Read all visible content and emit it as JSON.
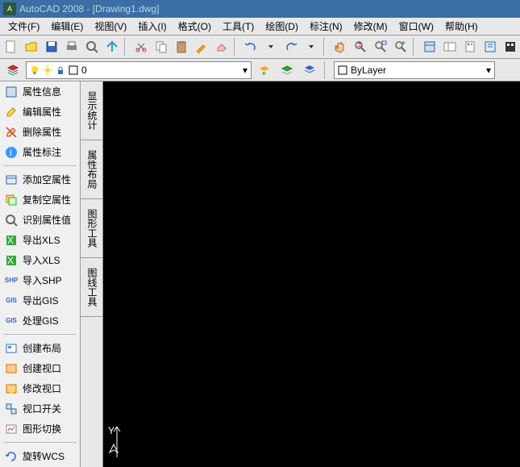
{
  "title": "AutoCAD 2008 - [Drawing1.dwg]",
  "menu": [
    "文件(F)",
    "编辑(E)",
    "视图(V)",
    "插入(I)",
    "格式(O)",
    "工具(T)",
    "绘图(D)",
    "标注(N)",
    "修改(M)",
    "窗口(W)",
    "帮助(H)"
  ],
  "layer": {
    "current": "0",
    "bylayer": "ByLayer"
  },
  "side_groups": [
    [
      "属性信息",
      "编辑属性",
      "删除属性",
      "属性标注"
    ],
    [
      "添加空属性",
      "复制空属性",
      "识别属性值",
      "导出XLS",
      "导入XLS",
      "导入SHP",
      "导出GIS",
      "处理GIS"
    ],
    [
      "创建布局",
      "创建视口",
      "修改视口",
      "视口开关",
      "图形切换"
    ],
    [
      "旋转WCS"
    ]
  ],
  "vtabs": [
    "显示统计",
    "属性布局",
    "图形工具",
    "图线工具"
  ],
  "ucs_y": "Y"
}
